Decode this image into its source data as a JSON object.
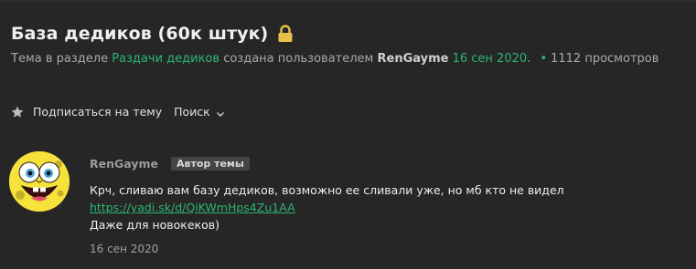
{
  "thread": {
    "title": "База дедиков (60к штук)",
    "lock_icon": "lock-icon"
  },
  "meta": {
    "prefix": "Тема в разделе",
    "section": "Раздачи дедиков",
    "created_by": "создана пользователем",
    "author": "RenGayme",
    "date": "16 сен 2020",
    "period": ".",
    "separator": "•",
    "views": "1112 просмотров"
  },
  "actions": {
    "subscribe_label": "Подписаться на тему",
    "search_label": "Поиск"
  },
  "post": {
    "author": "RenGayme",
    "badge": "Автор темы",
    "line1": "Крч, сливаю вам базу дедиков, возможно ее сливали уже, но мб кто не видел",
    "link": "https://yadi.sk/d/QiKWmHps4Zu1AA",
    "line3": "Даже для новокеков)",
    "date": "16 сен 2020"
  },
  "colors": {
    "background": "#262626",
    "accent": "#2bb673",
    "lock": "#e8c14a"
  }
}
